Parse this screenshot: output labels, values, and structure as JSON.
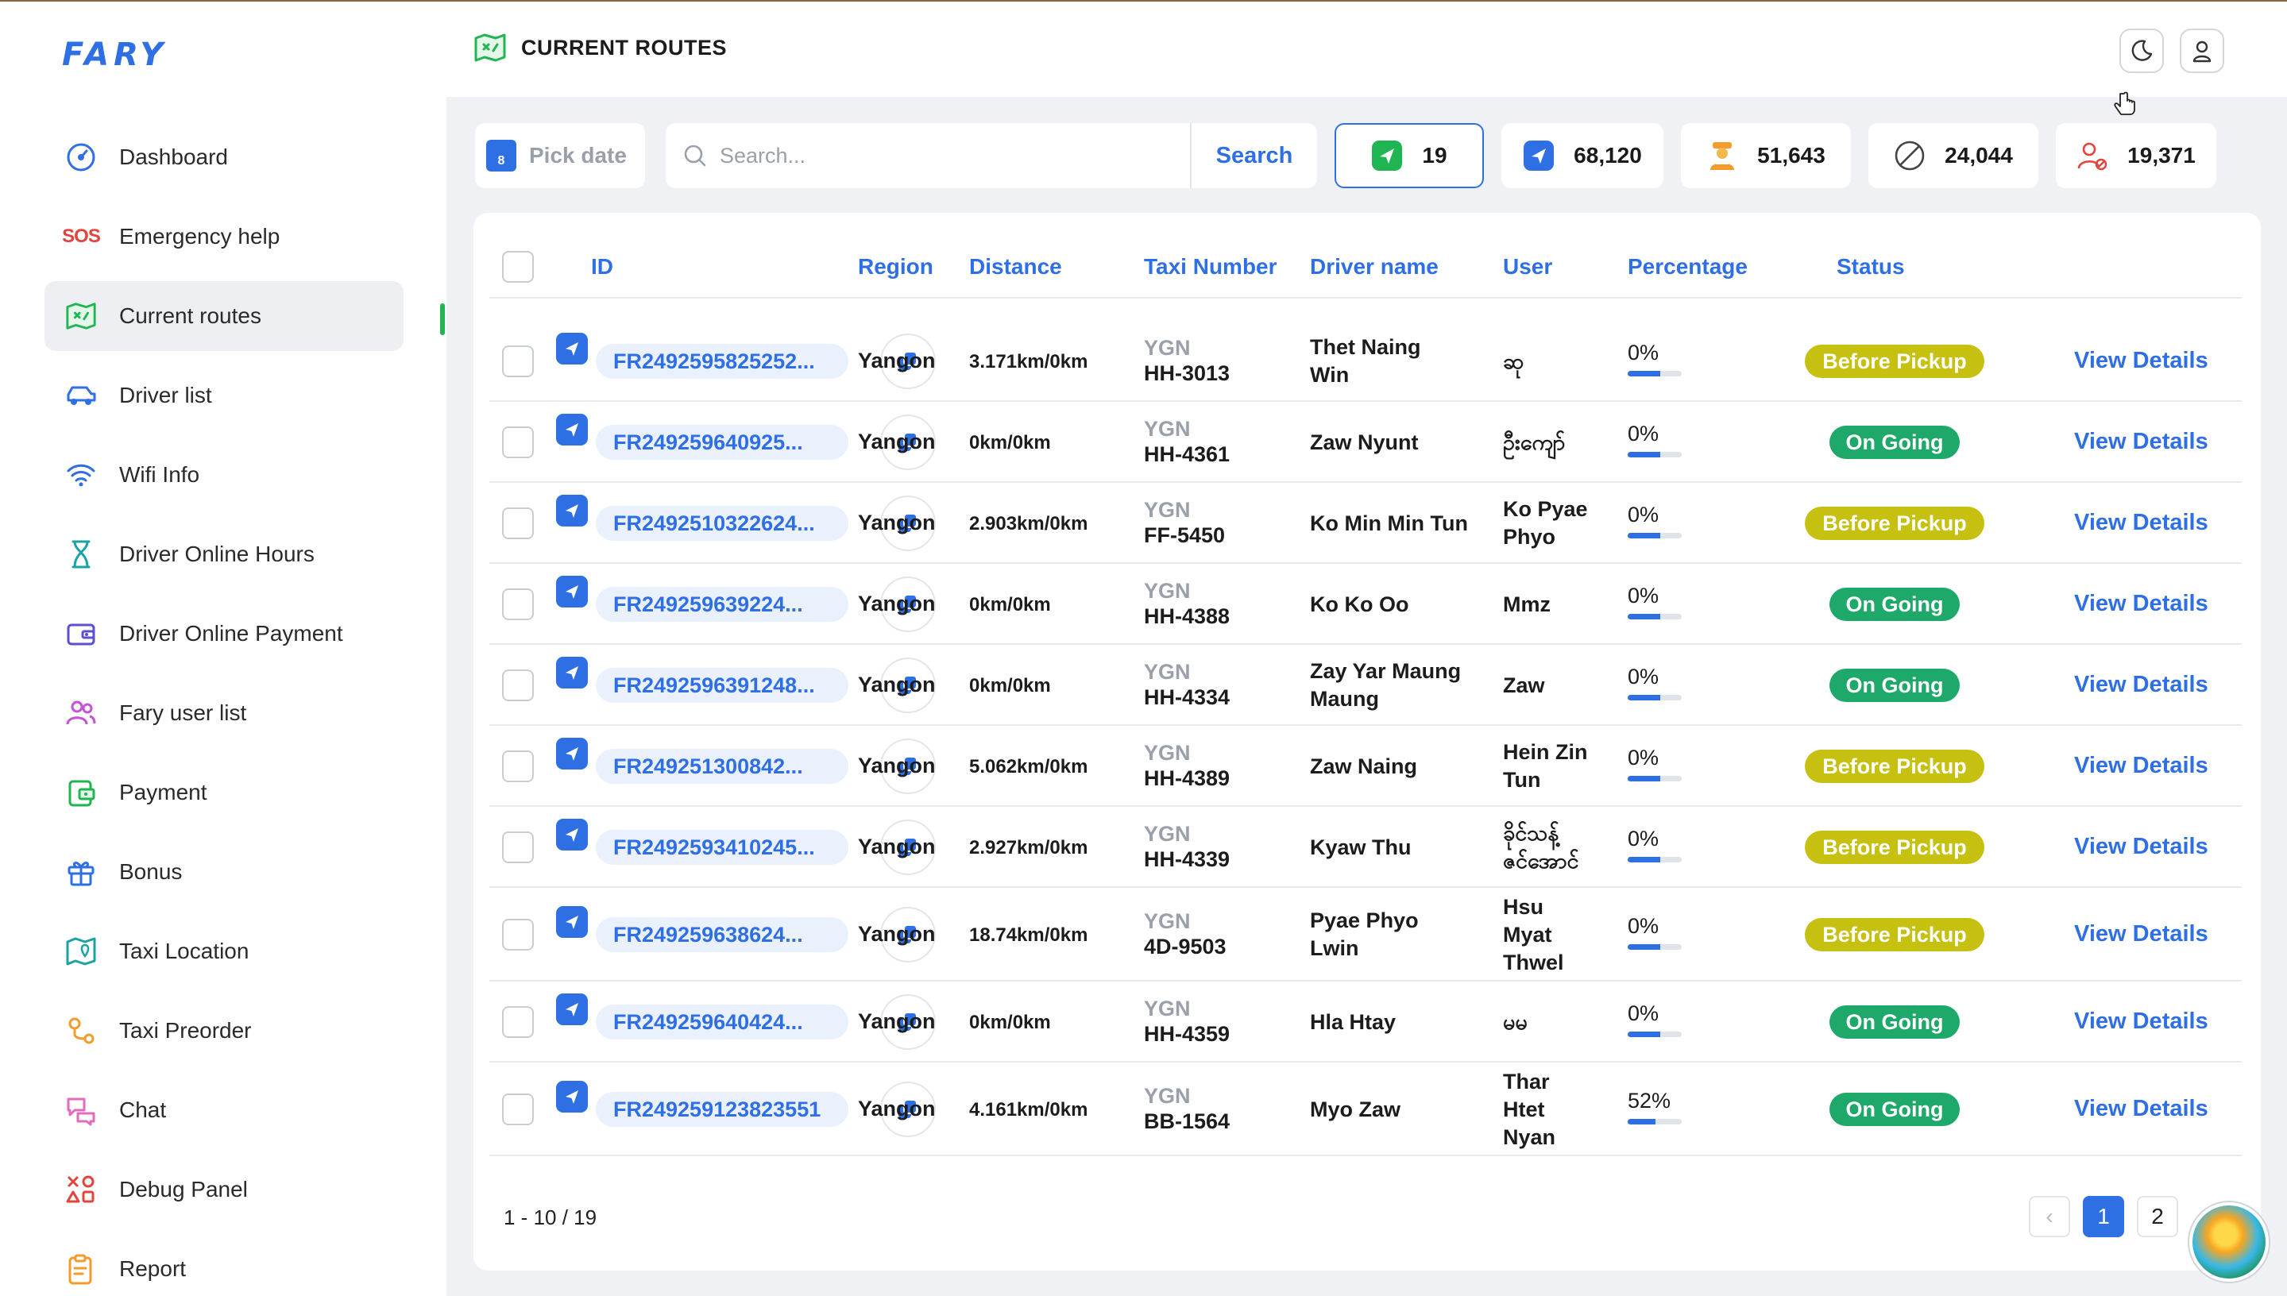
{
  "app": {
    "logo": "FARY",
    "title": "CURRENT ROUTES"
  },
  "sidebar": {
    "items": [
      {
        "label": "Dashboard",
        "icon": "dashboard-icon"
      },
      {
        "label": "Emergency help",
        "icon": "sos-icon",
        "icon_text": "SOS"
      },
      {
        "label": "Current routes",
        "icon": "route-map-icon"
      },
      {
        "label": "Driver list",
        "icon": "car-icon"
      },
      {
        "label": "Wifi Info",
        "icon": "wifi-icon"
      },
      {
        "label": "Driver Online Hours",
        "icon": "hourglass-icon"
      },
      {
        "label": "Driver Online Payment",
        "icon": "wallet-icon"
      },
      {
        "label": "Fary user list",
        "icon": "users-icon"
      },
      {
        "label": "Payment",
        "icon": "payment-icon"
      },
      {
        "label": "Bonus",
        "icon": "gift-icon"
      },
      {
        "label": "Taxi Location",
        "icon": "map-pin-icon"
      },
      {
        "label": "Taxi Preorder",
        "icon": "route-pins-icon"
      },
      {
        "label": "Chat",
        "icon": "chat-icon"
      },
      {
        "label": "Debug Panel",
        "icon": "debug-shapes-icon"
      },
      {
        "label": "Report",
        "icon": "report-clipboard-icon"
      }
    ],
    "active_index": 2
  },
  "toolbar": {
    "pick_date": "Pick date",
    "calendar_day": "8",
    "search_placeholder": "Search...",
    "search_label": "Search",
    "stats": [
      {
        "value": "19",
        "icon": "green-taxi-icon"
      },
      {
        "value": "68,120",
        "icon": "blue-taxi-icon"
      },
      {
        "value": "51,643",
        "icon": "driver-icon"
      },
      {
        "value": "24,044",
        "icon": "cancel-icon"
      },
      {
        "value": "19,371",
        "icon": "user-cancel-icon"
      }
    ]
  },
  "table": {
    "headers": {
      "id": "ID",
      "region": "Region",
      "distance": "Distance",
      "taxi_number": "Taxi Number",
      "driver": "Driver name",
      "user": "User",
      "percentage": "Percentage",
      "status": "Status"
    },
    "view_label": "View Details",
    "rows": [
      {
        "id": "FR2492595825252...",
        "region": "Yangon",
        "distance": "3.171km/0km",
        "taxi_region": "YGN",
        "taxi_no": "HH-3013",
        "driver": [
          "Thet Naing",
          "Win"
        ],
        "user": [
          "ဆု"
        ],
        "pct": "0%",
        "pct_value": 0,
        "status": "Before Pickup"
      },
      {
        "id": "FR249259640925...",
        "region": "Yangon",
        "distance": "0km/0km",
        "taxi_region": "YGN",
        "taxi_no": "HH-4361",
        "driver": [
          "Zaw Nyunt"
        ],
        "user": [
          "ဦးကျော်"
        ],
        "pct": "0%",
        "pct_value": 0,
        "status": "On Going"
      },
      {
        "id": "FR2492510322624...",
        "region": "Yangon",
        "distance": "2.903km/0km",
        "taxi_region": "YGN",
        "taxi_no": "FF-5450",
        "driver": [
          "Ko Min Min Tun"
        ],
        "user": [
          "Ko Pyae",
          "Phyo"
        ],
        "pct": "0%",
        "pct_value": 0,
        "status": "Before Pickup"
      },
      {
        "id": "FR249259639224...",
        "region": "Yangon",
        "distance": "0km/0km",
        "taxi_region": "YGN",
        "taxi_no": "HH-4388",
        "driver": [
          "Ko Ko Oo"
        ],
        "user": [
          "Mmz"
        ],
        "pct": "0%",
        "pct_value": 0,
        "status": "On Going"
      },
      {
        "id": "FR2492596391248...",
        "region": "Yangon",
        "distance": "0km/0km",
        "taxi_region": "YGN",
        "taxi_no": "HH-4334",
        "driver": [
          "Zay Yar Maung",
          "Maung"
        ],
        "user": [
          "Zaw"
        ],
        "pct": "0%",
        "pct_value": 0,
        "status": "On Going"
      },
      {
        "id": "FR249251300842...",
        "region": "Yangon",
        "distance": "5.062km/0km",
        "taxi_region": "YGN",
        "taxi_no": "HH-4389",
        "driver": [
          "Zaw Naing"
        ],
        "user": [
          "Hein Zin",
          "Tun"
        ],
        "pct": "0%",
        "pct_value": 0,
        "status": "Before Pickup"
      },
      {
        "id": "FR2492593410245...",
        "region": "Yangon",
        "distance": "2.927km/0km",
        "taxi_region": "YGN",
        "taxi_no": "HH-4339",
        "driver": [
          "Kyaw Thu"
        ],
        "user": [
          "ခိုင်သန့်",
          "ဇင်အောင်"
        ],
        "pct": "0%",
        "pct_value": 0,
        "status": "Before Pickup"
      },
      {
        "id": "FR249259638624...",
        "region": "Yangon",
        "distance": "18.74km/0km",
        "taxi_region": "YGN",
        "taxi_no": "4D-9503",
        "driver": [
          "Pyae Phyo",
          "Lwin"
        ],
        "user": [
          "Hsu",
          "Myat",
          "Thwel"
        ],
        "pct": "0%",
        "pct_value": 0,
        "status": "Before Pickup"
      },
      {
        "id": "FR249259640424...",
        "region": "Yangon",
        "distance": "0km/0km",
        "taxi_region": "YGN",
        "taxi_no": "HH-4359",
        "driver": [
          "Hla Htay"
        ],
        "user": [
          "မမ"
        ],
        "pct": "0%",
        "pct_value": 0,
        "status": "On Going"
      },
      {
        "id": "FR249259123823551",
        "region": "Yangon",
        "distance": "4.161km/0km",
        "taxi_region": "YGN",
        "taxi_no": "BB-1564",
        "driver": [
          "Myo Zaw"
        ],
        "user": [
          "Thar",
          "Htet",
          "Nyan"
        ],
        "pct": "52%",
        "pct_value": 52,
        "status": "On Going"
      }
    ]
  },
  "pagination": {
    "range": "1 - 10 / 19",
    "prev": "‹",
    "pages": [
      "1",
      "2"
    ],
    "current": "1"
  },
  "colors": {
    "accent": "#2f6fe4",
    "active_bar": "#1fb552",
    "before_pickup": "#c6c011",
    "on_going": "#1ea86a"
  }
}
